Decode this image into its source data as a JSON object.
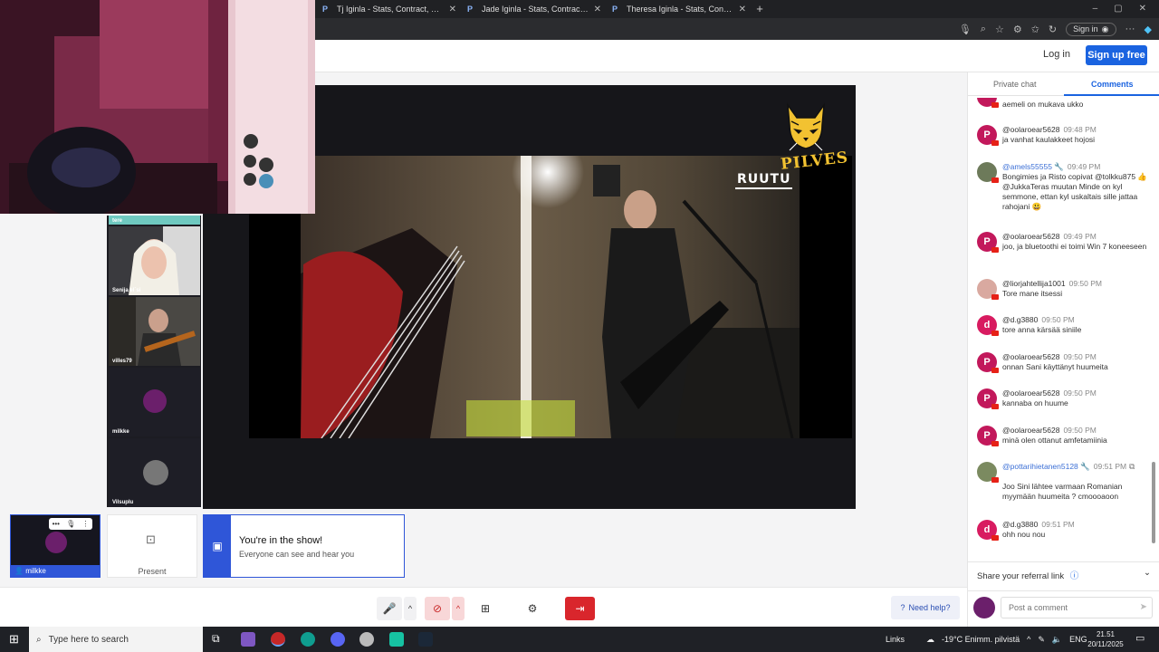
{
  "browser": {
    "tabs": [
      {
        "favicon": "P",
        "title": "Tj Iginla - Stats, Contract, Salary & More"
      },
      {
        "favicon": "P",
        "title": "Jade Iginla - Stats, Contract, Salary & More"
      },
      {
        "favicon": "P",
        "title": "Theresa Iginla - Stats, Contract, Salary & More"
      }
    ],
    "new_tab": "+",
    "window_controls": {
      "minimize": "–",
      "maximize": "▢",
      "close": "✕"
    },
    "toolbar_icons": [
      "mic-icon",
      "zoom-icon",
      "favorite-icon",
      "extensions-icon",
      "favorites-icon",
      "history-icon"
    ],
    "signin_label": "Sign in",
    "more": "···"
  },
  "header": {
    "login": "Log in",
    "signup": "Sign up free"
  },
  "stage": {
    "brand_word": "PILVES",
    "watermark": "RUUTU"
  },
  "participants": [
    {
      "name": "tere"
    },
    {
      "name": "Senija el´si"
    },
    {
      "name": "villes79"
    },
    {
      "name": "milkke"
    },
    {
      "name": "Vilsuplu"
    }
  ],
  "self_tile": {
    "name": "milkke"
  },
  "present": {
    "label": "Present"
  },
  "show_card": {
    "title": "You're in the show!",
    "subtitle": "Everyone can see and hear you"
  },
  "toolbar": {
    "need_help": "Need help?"
  },
  "panel": {
    "tabs": [
      "Private chat",
      "Comments"
    ],
    "active_tab": "Comments",
    "comments": [
      {
        "avatar": "",
        "author": "",
        "time": "",
        "text": "aemeli on mukava ukko",
        "color": "#c2185b"
      },
      {
        "avatar": "P",
        "author": "@oolaroear5628",
        "time": "09:48 PM",
        "text": "ja vanhat kaulakkeet hojosi",
        "color": "#c2185b"
      },
      {
        "avatar": "",
        "author": "@amels55555",
        "time": "09:49 PM",
        "text": "Bongimies ja Risto copivat @tolkku875 👍 @JukkaTeras muutan Minde on kyl semmone, ettan kyl uskaltais sille jattaa rahojani 😃",
        "color": "#6d7a5a",
        "mod": true
      },
      {
        "avatar": "P",
        "author": "@oolaroear5628",
        "time": "09:49 PM",
        "text": "joo, ja bluetoothi ei toimi Win 7 koneeseen",
        "color": "#c2185b"
      },
      {
        "avatar": "",
        "author": "@liorjahtellija1001",
        "time": "09:50 PM",
        "text": "Tore mane itsessi",
        "color": "#d9a9a0"
      },
      {
        "avatar": "d",
        "author": "@d.g3880",
        "time": "09:50 PM",
        "text": "tore anna kärsää siniile",
        "color": "#d81b60"
      },
      {
        "avatar": "P",
        "author": "@oolaroear5628",
        "time": "09:50 PM",
        "text": "onnan Sani käyttänyt huumeita",
        "color": "#c2185b"
      },
      {
        "avatar": "P",
        "author": "@oolaroear5628",
        "time": "09:50 PM",
        "text": "kannaba on huume",
        "color": "#c2185b"
      },
      {
        "avatar": "P",
        "author": "@oolaroear5628",
        "time": "09:50 PM",
        "text": "minä olen ottanut amfetamiinia",
        "color": "#c2185b"
      },
      {
        "avatar": "",
        "author": "@pottarihietanen5128",
        "time": "09:51 PM",
        "text": "Joo Sini lähtee varmaan Romanian myymään huumeita ? cmoooaoon",
        "color": "#7b8a60",
        "mod": true
      },
      {
        "avatar": "d",
        "author": "@d.g3880",
        "time": "09:51 PM",
        "text": "ohh nou nou",
        "color": "#d81b60"
      }
    ],
    "referral": "Share your referral link",
    "post_placeholder": "Post a comment"
  },
  "taskbar": {
    "search_placeholder": "Type here to search",
    "links": "Links",
    "weather": "-19°C  Enimm. pilvistä",
    "lang": "ENG",
    "time": "21.51",
    "date": "20/11/2025"
  },
  "colors": {
    "accent": "#1a63e0",
    "leave": "#d9262c",
    "stage_bg": "#16161a"
  }
}
